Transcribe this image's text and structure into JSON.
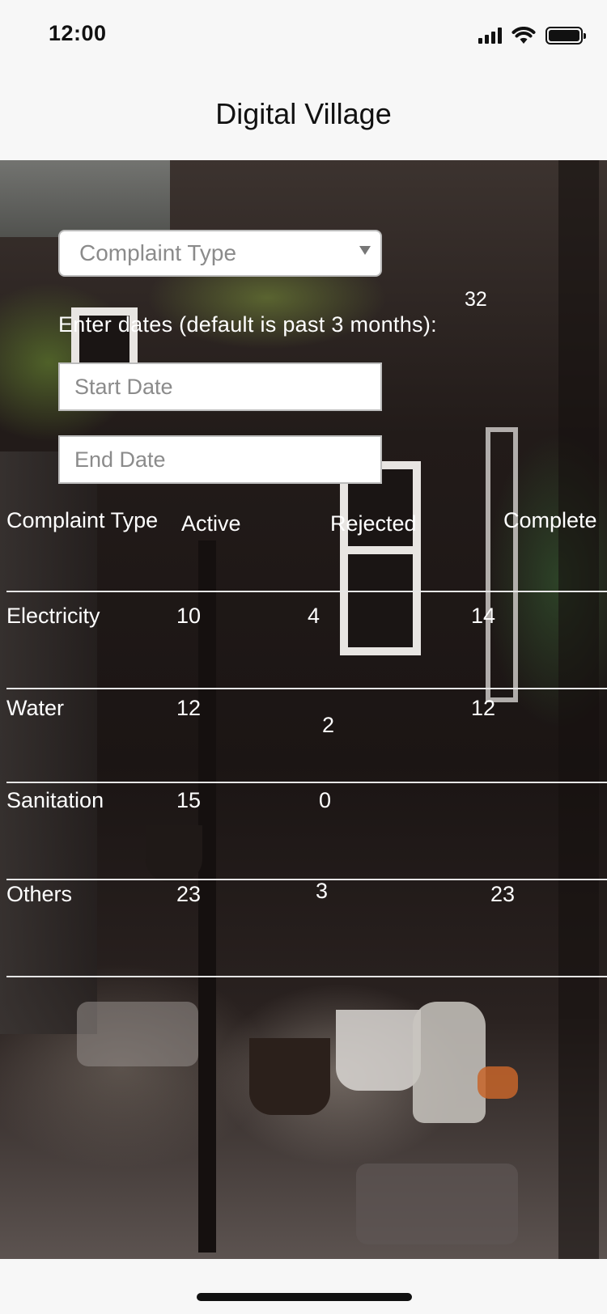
{
  "status_bar": {
    "time": "12:00"
  },
  "header": {
    "title": "Digital Village"
  },
  "form": {
    "complaint_type_placeholder": "Complaint Type",
    "date_prompt": "Enter dates (default is past 3 months):",
    "floating_count": "32",
    "start_date_placeholder": "Start Date",
    "end_date_placeholder": "End Date"
  },
  "table": {
    "headers": [
      "Complaint Type",
      "Active",
      "Rejected",
      "Complete"
    ],
    "rows": [
      {
        "type": "Electricity",
        "active": "10",
        "rejected": "4",
        "complete": "14"
      },
      {
        "type": "Water",
        "active": "12",
        "rejected": "2",
        "complete": "12"
      },
      {
        "type": "Sanitation",
        "active": "15",
        "rejected": "0",
        "complete": ""
      },
      {
        "type": "Others",
        "active": "23",
        "rejected": "3",
        "complete": "23"
      }
    ]
  }
}
